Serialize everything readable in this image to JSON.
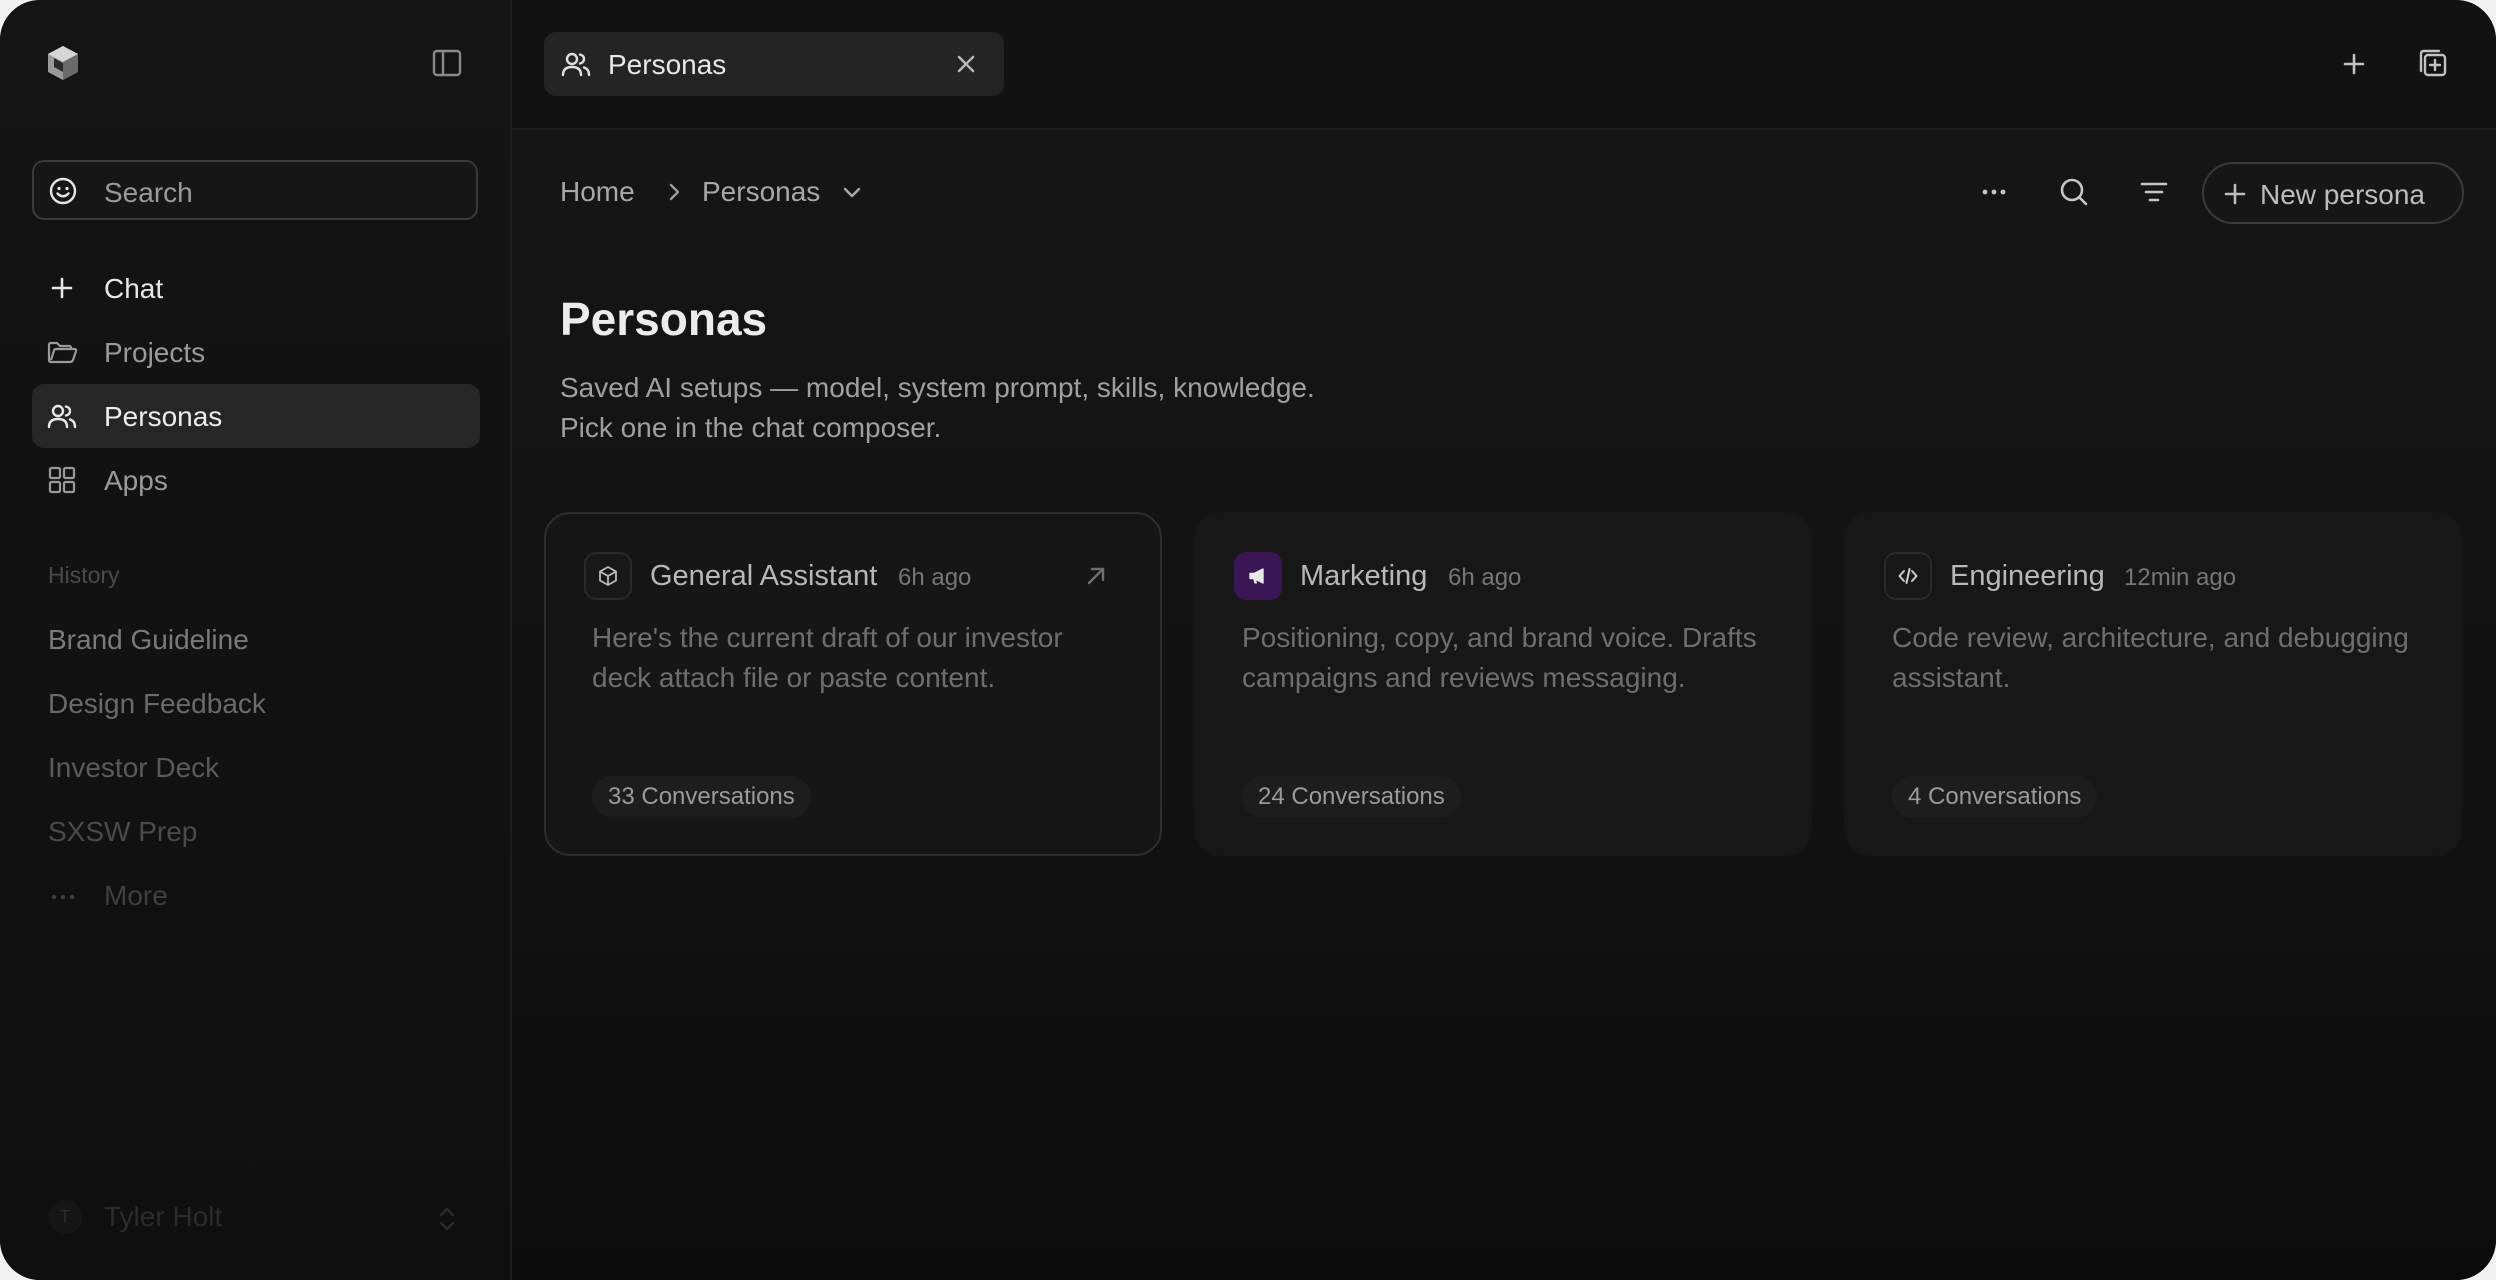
{
  "sidebar": {
    "search_label": "Search",
    "nav": [
      {
        "label": "Chat",
        "icon": "plus-icon"
      },
      {
        "label": "Projects",
        "icon": "folder-icon"
      },
      {
        "label": "Personas",
        "icon": "users-icon",
        "active": true
      },
      {
        "label": "Apps",
        "icon": "grid-icon"
      }
    ],
    "history_label": "History",
    "history": [
      "Brand Guideline",
      "Design Feedback",
      "Investor Deck",
      "SXSW Prep"
    ],
    "more_label": "More",
    "user": {
      "initial": "T",
      "name": "Tyler Holt"
    }
  },
  "tabbar": {
    "tab_label": "Personas"
  },
  "breadcrumb": {
    "home": "Home",
    "current": "Personas"
  },
  "actions": {
    "new_label": "New persona"
  },
  "page": {
    "title": "Personas",
    "desc_line1": "Saved AI setups — model, system prompt, skills, knowledge.",
    "desc_line2": "Pick one in the chat composer."
  },
  "cards": [
    {
      "name": "General Assistant",
      "time": "6h ago",
      "icon": "cube-icon",
      "body": "Here's the current draft of our investor deck attach file or paste content.",
      "count": "33 Conversations"
    },
    {
      "name": "Marketing",
      "time": "6h ago",
      "icon": "megaphone-icon",
      "body": "Positioning, copy, and brand voice. Drafts campaigns and reviews messaging.",
      "count": "24 Conversations"
    },
    {
      "name": "Engineering",
      "time": "12min ago",
      "icon": "code-icon",
      "body": "Code review, architecture, and debugging assistant.",
      "count": "4 Conversations"
    }
  ],
  "colors": {
    "background": "#111111",
    "sidebar_active": "#262626",
    "marketing_accent": "#3a1657"
  }
}
